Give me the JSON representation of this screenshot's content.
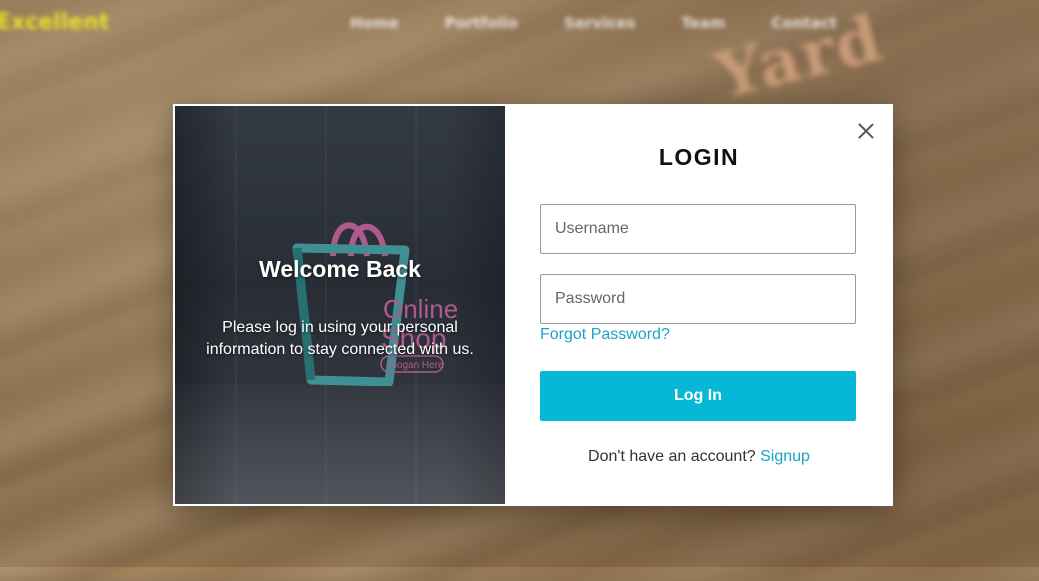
{
  "background": {
    "brand": "Excellent",
    "nav": [
      "Home",
      "Portfolio",
      "Services",
      "Team",
      "Contact"
    ],
    "decor_text": "Yard"
  },
  "modal": {
    "left": {
      "welcome_title": "Welcome Back",
      "welcome_text": "Please log in using your personal information to stay connected with us.",
      "logo_line1": "Online",
      "logo_line2": "Shop",
      "logo_slogan": "Slogan Here"
    },
    "right": {
      "title": "LOGIN",
      "username_placeholder": "Username",
      "password_placeholder": "Password",
      "forgot_label": "Forgot Password?",
      "login_button": "Log In",
      "no_account_text": "Don't have an account?",
      "signup_label": "Signup"
    }
  },
  "colors": {
    "accent": "#07b8d6",
    "link": "#1aa3c8",
    "logo_pink": "#e36fb4",
    "logo_teal": "#4fb7b8"
  }
}
